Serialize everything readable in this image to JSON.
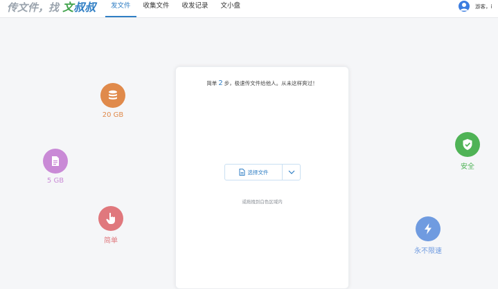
{
  "brand": {
    "prefix": "传文件，找",
    "name_part1": "文",
    "name_part2": "叔叔"
  },
  "nav": [
    {
      "label": "发文件",
      "active": true
    },
    {
      "label": "收集文件",
      "active": false
    },
    {
      "label": "收发记录",
      "active": false
    },
    {
      "label": "文小盘",
      "active": false
    }
  ],
  "user": {
    "name": "游客，i"
  },
  "features": {
    "storage20": {
      "label": "20 GB",
      "color": "#e08a4b",
      "icon": "database-icon"
    },
    "storage5": {
      "label": "5 GB",
      "color": "#c98ad6",
      "icon": "file-icon"
    },
    "simple": {
      "label": "简单",
      "color": "#e0787d",
      "icon": "hand-pointer-icon"
    },
    "secure": {
      "label": "安全",
      "color": "#4fb356",
      "icon": "shield-check-icon"
    },
    "fast": {
      "label": "永不限速",
      "color": "#6f9be0",
      "icon": "lightning-icon"
    }
  },
  "upload": {
    "head_prefix": "简单",
    "head_num": "2",
    "head_suffix": "步，极速传文件给他人。从未这样爽过！",
    "select_label": "选择文件",
    "drag_hint": "或拖拽到白色区域内"
  },
  "colors": {
    "accent": "#2f7ec4",
    "background": "#f5f6f8"
  }
}
